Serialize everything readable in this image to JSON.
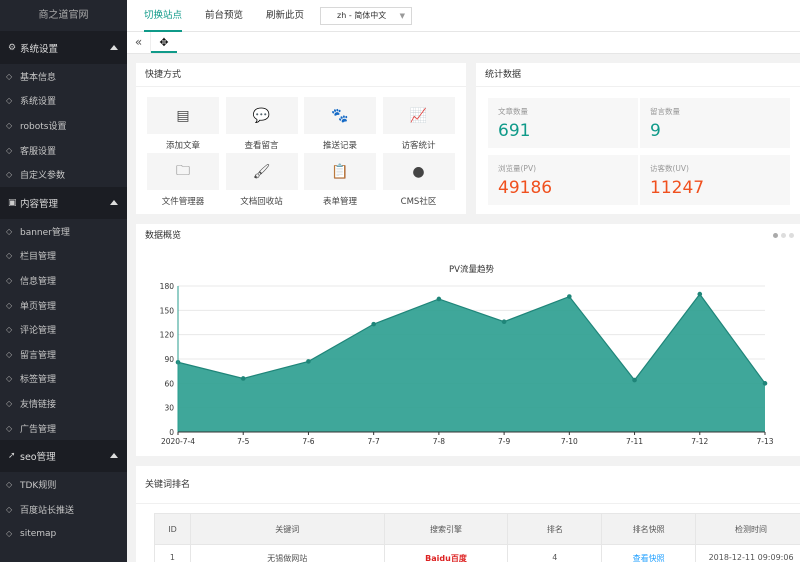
{
  "sidebar": {
    "logo": "商之道官网",
    "groups": [
      {
        "label": "系统设置",
        "icon": "gear-icon",
        "items": [
          {
            "label": "基本信息",
            "icon": "settings-icon"
          },
          {
            "label": "系统设置",
            "icon": "tools-icon"
          },
          {
            "label": "robots设置",
            "icon": "robot-icon"
          },
          {
            "label": "客服设置",
            "icon": "headset-icon"
          },
          {
            "label": "自定义参数",
            "icon": "sliders-icon"
          }
        ]
      },
      {
        "label": "内容管理",
        "icon": "content-icon",
        "items": [
          {
            "label": "banner管理",
            "icon": "image-icon"
          },
          {
            "label": "栏目管理",
            "icon": "list-icon"
          },
          {
            "label": "信息管理",
            "icon": "info-icon"
          },
          {
            "label": "单页管理",
            "icon": "page-icon"
          },
          {
            "label": "评论管理",
            "icon": "comment-icon"
          },
          {
            "label": "留言管理",
            "icon": "message-icon"
          },
          {
            "label": "标签管理",
            "icon": "tag-icon"
          },
          {
            "label": "友情链接",
            "icon": "link-icon"
          },
          {
            "label": "广告管理",
            "icon": "ad-icon"
          }
        ]
      },
      {
        "label": "seo管理",
        "icon": "rocket-icon",
        "items": [
          {
            "label": "TDK规则",
            "icon": "rule-icon"
          },
          {
            "label": "百度站长推送",
            "icon": "push-icon"
          },
          {
            "label": "sitemap",
            "icon": "sitemap-icon"
          }
        ]
      }
    ]
  },
  "topbar": {
    "nav": [
      "切换站点",
      "前台预览",
      "刷新此页"
    ],
    "lang": "zh - 简体中文"
  },
  "quick": {
    "title": "快捷方式",
    "items": [
      {
        "label": "添加文章",
        "icon": "document-icon",
        "glyph": "▤"
      },
      {
        "label": "查看留言",
        "icon": "chat-icon",
        "glyph": "💬"
      },
      {
        "label": "推送记录",
        "icon": "paw-icon",
        "glyph": "🐾"
      },
      {
        "label": "访客统计",
        "icon": "chart-line-icon",
        "glyph": "📈"
      },
      {
        "label": "文件管理器",
        "icon": "folder-icon",
        "glyph": "🗀"
      },
      {
        "label": "文档回收站",
        "icon": "brush-icon",
        "glyph": "🖌"
      },
      {
        "label": "表单管理",
        "icon": "form-icon",
        "glyph": "📋"
      },
      {
        "label": "CMS社区",
        "icon": "community-icon",
        "glyph": "●"
      }
    ]
  },
  "stats": {
    "title": "统计数据",
    "items": [
      {
        "label": "文章数量",
        "value": "691",
        "color": "#0f9a89"
      },
      {
        "label": "留言数量",
        "value": "9",
        "color": "#0f9a89"
      },
      {
        "label": "浏览量(PV)",
        "value": "49186",
        "color": "#f0501e"
      },
      {
        "label": "访客数(UV)",
        "value": "11247",
        "color": "#f0501e"
      }
    ]
  },
  "overview": {
    "title": "数据概览"
  },
  "chart_data": {
    "type": "area",
    "title": "PV流量趋势",
    "categories": [
      "2020-7-4",
      "7-5",
      "7-6",
      "7-7",
      "7-8",
      "7-9",
      "7-10",
      "7-11",
      "7-12",
      "7-13"
    ],
    "series": [
      {
        "values": [
          86,
          66,
          87,
          133,
          164,
          136,
          167,
          64,
          170,
          60
        ]
      }
    ],
    "ylim": [
      0,
      180
    ],
    "yticks": [
      0,
      30,
      60,
      90,
      120,
      150,
      180
    ],
    "color": "#2a9d8f",
    "grid": true
  },
  "keywords": {
    "title": "关键词排名",
    "headers": [
      "ID",
      "关键词",
      "搜索引擎",
      "排名",
      "排名快照",
      "检测时间"
    ],
    "rows": [
      {
        "id": "1",
        "keyword": "无锡做网站",
        "engine": "Baidu百度",
        "rank": "4",
        "snapshot": "查看快照",
        "time": "2018-12-11 09:09:06"
      }
    ]
  }
}
